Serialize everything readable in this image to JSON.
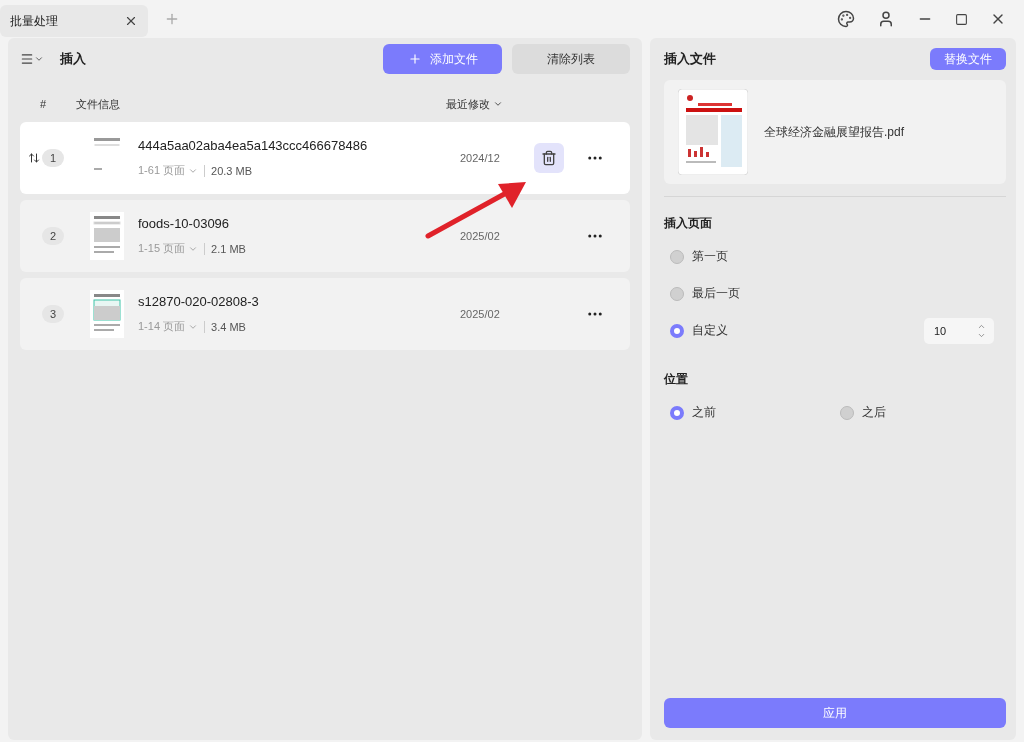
{
  "tab": {
    "title": "批量处理"
  },
  "toolbar": {
    "title": "插入",
    "add_button": "添加文件",
    "clear_button": "清除列表"
  },
  "table": {
    "columns": [
      "#",
      "文件信息",
      "最近修改"
    ],
    "rows": [
      {
        "index": "1",
        "name": "444a5aa02aba4ea5a143ccc466678486",
        "pages": "1-61 页面",
        "size": "20.3 MB",
        "modified": "2024/12",
        "selected": true
      },
      {
        "index": "2",
        "name": "foods-10-03096",
        "pages": "1-15 页面",
        "size": "2.1 MB",
        "modified": "2025/02",
        "selected": false
      },
      {
        "index": "3",
        "name": "s12870-020-02808-3",
        "pages": "1-14 页面",
        "size": "3.4 MB",
        "modified": "2025/02",
        "selected": false
      }
    ]
  },
  "insert_file": {
    "title": "插入文件",
    "replace_button": "替换文件",
    "file_name": "全球经济金融展望报告.pdf"
  },
  "insert_page": {
    "title": "插入页面",
    "options": [
      {
        "label": "第一页",
        "selected": false
      },
      {
        "label": "最后一页",
        "selected": false
      },
      {
        "label": "自定义",
        "selected": true,
        "value": "10"
      }
    ]
  },
  "position": {
    "title": "位置",
    "options": [
      {
        "label": "之前",
        "selected": true
      },
      {
        "label": "之后",
        "selected": false
      }
    ]
  },
  "apply_button": "应用"
}
